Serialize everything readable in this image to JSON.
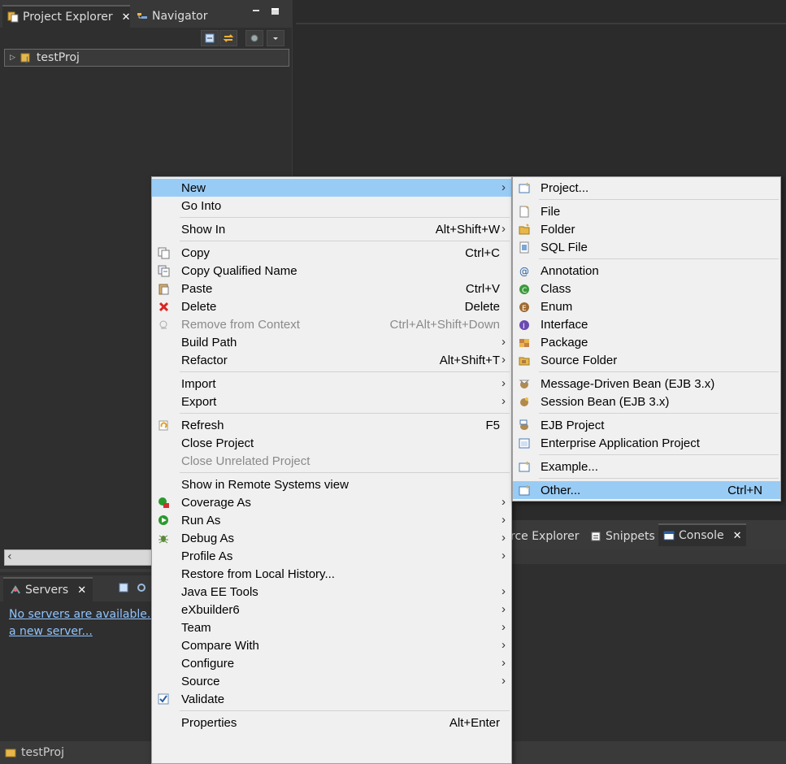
{
  "project_explorer": {
    "tabs": [
      {
        "label": "Project Explorer",
        "close": "✕"
      },
      {
        "label": "Navigator"
      }
    ],
    "tree": [
      {
        "label": "testProj",
        "expander": "▷"
      }
    ]
  },
  "servers": {
    "tab_label": "Servers",
    "close": "✕",
    "message_line1": "No servers are available. C",
    "message_line2": "a new server..."
  },
  "bottom_tabs": [
    {
      "label": "rce Explorer"
    },
    {
      "label": "Snippets"
    },
    {
      "label": "Console",
      "close": "✕"
    }
  ],
  "status_bar": {
    "label": "testProj"
  },
  "context_menu": {
    "items": [
      {
        "label": "New",
        "shortcut": "",
        "submenu": true,
        "highlighted": true
      },
      {
        "label": "Go Into",
        "shortcut": ""
      },
      {
        "separator": true
      },
      {
        "label": "Show In",
        "shortcut": "Alt+Shift+W",
        "submenu": true
      },
      {
        "separator": true
      },
      {
        "label": "Copy",
        "shortcut": "Ctrl+C",
        "icon": "copy-icon"
      },
      {
        "label": "Copy Qualified Name",
        "shortcut": "",
        "icon": "copy-qualified-icon"
      },
      {
        "label": "Paste",
        "shortcut": "Ctrl+V",
        "icon": "paste-icon"
      },
      {
        "label": "Delete",
        "shortcut": "Delete",
        "icon": "delete-icon"
      },
      {
        "label": "Remove from Context",
        "shortcut": "Ctrl+Alt+Shift+Down",
        "icon": "remove-context-icon",
        "disabled": true
      },
      {
        "label": "Build Path",
        "shortcut": "",
        "submenu": true
      },
      {
        "label": "Refactor",
        "shortcut": "Alt+Shift+T",
        "submenu": true
      },
      {
        "separator": true
      },
      {
        "label": "Import",
        "shortcut": "",
        "submenu": true
      },
      {
        "label": "Export",
        "shortcut": "",
        "submenu": true
      },
      {
        "separator": true
      },
      {
        "label": "Refresh",
        "shortcut": "F5",
        "icon": "refresh-icon"
      },
      {
        "label": "Close Project",
        "shortcut": ""
      },
      {
        "label": "Close Unrelated Project",
        "shortcut": "",
        "disabled": true
      },
      {
        "separator": true
      },
      {
        "label": "Show in Remote Systems view",
        "shortcut": ""
      },
      {
        "label": "Coverage As",
        "shortcut": "",
        "submenu": true,
        "icon": "coverage-icon"
      },
      {
        "label": "Run As",
        "shortcut": "",
        "submenu": true,
        "icon": "run-icon"
      },
      {
        "label": "Debug As",
        "shortcut": "",
        "submenu": true,
        "icon": "debug-icon"
      },
      {
        "label": "Profile As",
        "shortcut": "",
        "submenu": true
      },
      {
        "label": "Restore from Local History...",
        "shortcut": ""
      },
      {
        "label": "Java EE Tools",
        "shortcut": "",
        "submenu": true
      },
      {
        "label": "eXbuilder6",
        "shortcut": "",
        "submenu": true
      },
      {
        "label": "Team",
        "shortcut": "",
        "submenu": true
      },
      {
        "label": "Compare With",
        "shortcut": "",
        "submenu": true
      },
      {
        "label": "Configure",
        "shortcut": "",
        "submenu": true
      },
      {
        "label": "Source",
        "shortcut": "",
        "submenu": true
      },
      {
        "label": "Validate",
        "shortcut": "",
        "icon": "checkbox-icon"
      },
      {
        "separator": true
      },
      {
        "label": "Properties",
        "shortcut": "Alt+Enter"
      }
    ]
  },
  "new_submenu": {
    "items": [
      {
        "label": "Project...",
        "shortcut": "",
        "icon": "new-project-icon"
      },
      {
        "separator": true
      },
      {
        "label": "File",
        "shortcut": "",
        "icon": "file-icon"
      },
      {
        "label": "Folder",
        "shortcut": "",
        "icon": "folder-icon"
      },
      {
        "label": "SQL File",
        "shortcut": "",
        "icon": "sql-file-icon"
      },
      {
        "separator": true
      },
      {
        "label": "Annotation",
        "shortcut": "",
        "icon": "annotation-icon"
      },
      {
        "label": "Class",
        "shortcut": "",
        "icon": "class-icon"
      },
      {
        "label": "Enum",
        "shortcut": "",
        "icon": "enum-icon"
      },
      {
        "label": "Interface",
        "shortcut": "",
        "icon": "interface-icon"
      },
      {
        "label": "Package",
        "shortcut": "",
        "icon": "package-icon"
      },
      {
        "label": "Source Folder",
        "shortcut": "",
        "icon": "source-folder-icon"
      },
      {
        "separator": true
      },
      {
        "label": "Message-Driven Bean (EJB 3.x)",
        "shortcut": "",
        "icon": "mdb-icon"
      },
      {
        "label": "Session Bean (EJB 3.x)",
        "shortcut": "",
        "icon": "session-bean-icon"
      },
      {
        "separator": true
      },
      {
        "label": "EJB Project",
        "shortcut": "",
        "icon": "ejb-project-icon"
      },
      {
        "label": "Enterprise Application Project",
        "shortcut": "",
        "icon": "ear-project-icon"
      },
      {
        "separator": true
      },
      {
        "label": "Example...",
        "shortcut": "",
        "icon": "example-icon"
      },
      {
        "separator": true
      },
      {
        "label": "Other...",
        "shortcut": "Ctrl+N",
        "icon": "other-wizard-icon",
        "highlighted": true
      }
    ]
  },
  "colors": {
    "highlight": "#99ccf5",
    "menu_bg": "#f0f0f0",
    "workbench_bg": "#2b2b2b",
    "link": "#8fc4ff"
  }
}
